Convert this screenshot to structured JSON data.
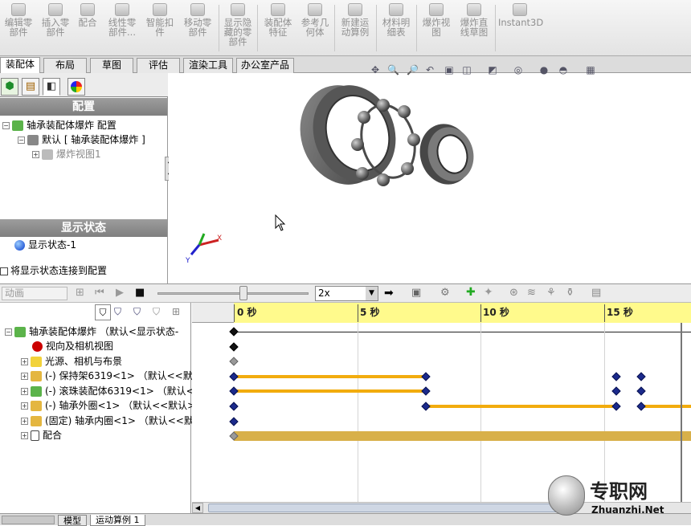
{
  "ribbon": {
    "buttons": [
      "编辑零部件",
      "插入零部件",
      "配合",
      "线性零部件...",
      "智能扣件",
      "移动零部件",
      "显示隐藏的零部件",
      "装配体特征",
      "参考几何体",
      "新建运动算例",
      "材料明细表",
      "爆炸视图",
      "爆炸直线草图",
      "Instant3D"
    ]
  },
  "tabs": [
    "装配体",
    "布局",
    "草图",
    "评估",
    "渲染工具",
    "办公室产品"
  ],
  "left_panel": {
    "config_header": "配置",
    "config_root": "轴承装配体爆炸 配置",
    "config_default": "默认 [ 轴承装配体爆炸 ]",
    "explode_view": "爆炸视图1",
    "display_header": "显示状态",
    "display_state": "显示状态-1",
    "link_checkbox_label": "将显示状态连接到配置"
  },
  "anim_toolbar": {
    "study_type": "动画",
    "speed": "2x"
  },
  "motion_tree": {
    "items": [
      "轴承装配体爆炸 （默认<显示状态-",
      "视向及相机视图",
      "光源、相机与布景",
      "(-) 保持架6319<1> （默认<<默认",
      "(-) 滚珠装配体6319<1> （默认<",
      "(-) 轴承外圈<1> （默认<<默认>",
      "(固定) 轴承内圈<1> （默认<<默",
      "配合"
    ]
  },
  "timeline": {
    "ruler_labels": [
      "0 秒",
      "5 秒",
      "10 秒",
      "15 秒"
    ],
    "keyframes": [
      {
        "row": 0,
        "t": [
          0
        ]
      },
      {
        "row": 1,
        "t": [
          0
        ]
      },
      {
        "row": 2,
        "t": [
          0
        ],
        "grey": true
      },
      {
        "row": 3,
        "t": [
          0,
          7.8,
          15.5,
          16.5
        ]
      },
      {
        "row": 4,
        "t": [
          0,
          7.8,
          15.5,
          16.5
        ]
      },
      {
        "row": 5,
        "t": [
          0,
          7.8,
          15.5,
          16.5
        ]
      },
      {
        "row": 6,
        "t": [
          0
        ]
      },
      {
        "row": 7,
        "t": [
          0
        ],
        "grey": true
      }
    ],
    "bars": [
      {
        "row": 3,
        "from": 0,
        "to": 7.8
      },
      {
        "row": 4,
        "from": 0,
        "to": 7.8
      },
      {
        "row": 5,
        "from": 7.8,
        "to": 15.5
      },
      {
        "row": 5,
        "from": 16.5,
        "to": 19.5
      }
    ],
    "colors": {
      "bar": "#f2ac0e",
      "key": "#1b2a8c",
      "ruler": "#fffa8c"
    }
  },
  "bottom_tabs": [
    "模型",
    "运动算例 1"
  ],
  "watermark": {
    "brand": "专职网",
    "url": "Zhuanzhi.Net"
  }
}
